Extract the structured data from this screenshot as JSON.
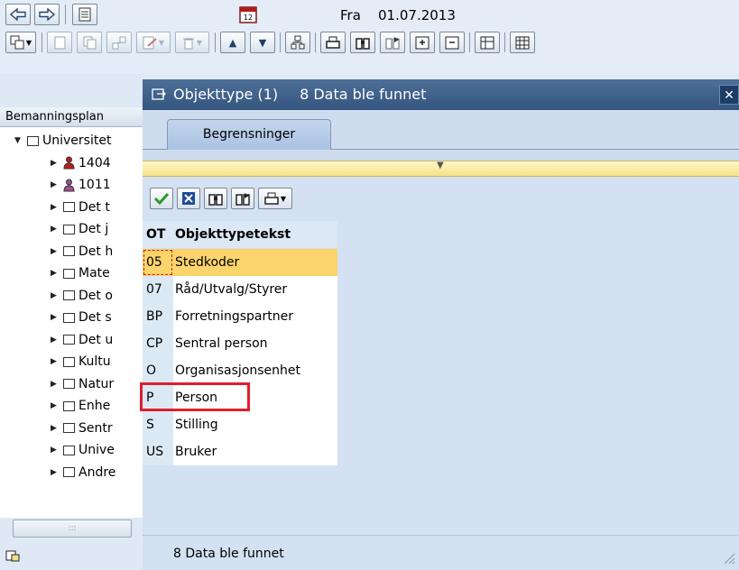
{
  "header": {
    "date_label": "Fra",
    "date_value": "01.07.2013"
  },
  "tree": {
    "header": "Bemanningsplan",
    "items": [
      {
        "label": "Universitet",
        "icon": "folder-icon",
        "level": 0,
        "expanded": true
      },
      {
        "label": "1404",
        "icon": "person-red-icon",
        "level": 1
      },
      {
        "label": "1011",
        "icon": "person-icon",
        "level": 1
      },
      {
        "label": "Det t",
        "icon": "folder-icon",
        "level": 1
      },
      {
        "label": "Det j",
        "icon": "folder-icon",
        "level": 1
      },
      {
        "label": "Det h",
        "icon": "folder-icon",
        "level": 1
      },
      {
        "label": "Mate",
        "icon": "folder-icon",
        "level": 1
      },
      {
        "label": "Det o",
        "icon": "folder-icon",
        "level": 1
      },
      {
        "label": "Det s",
        "icon": "folder-icon",
        "level": 1
      },
      {
        "label": "Det u",
        "icon": "folder-icon",
        "level": 1
      },
      {
        "label": "Kultu",
        "icon": "folder-icon",
        "level": 1
      },
      {
        "label": "Natur",
        "icon": "folder-icon",
        "level": 1
      },
      {
        "label": "Enhe",
        "icon": "folder-icon",
        "level": 1
      },
      {
        "label": "Sentr",
        "icon": "folder-icon",
        "level": 1
      },
      {
        "label": "Unive",
        "icon": "folder-icon",
        "level": 1
      },
      {
        "label": "Andre",
        "icon": "folder-icon",
        "level": 1
      }
    ]
  },
  "dialog": {
    "title": "Objekttype (1)",
    "title_info": "8 Data ble funnet",
    "tab_label": "Begrensninger",
    "columns": [
      "OT",
      "Objekttypetekst"
    ],
    "rows": [
      {
        "ot": "05",
        "text": "Stedkoder",
        "selected": true
      },
      {
        "ot": "07",
        "text": "Råd/Utvalg/Styrer"
      },
      {
        "ot": "BP",
        "text": "Forretningspartner"
      },
      {
        "ot": "CP",
        "text": "Sentral person"
      },
      {
        "ot": "O",
        "text": "Organisasjonsenhet"
      },
      {
        "ot": "P",
        "text": "Person",
        "highlighted": true
      },
      {
        "ot": "S",
        "text": "Stilling"
      },
      {
        "ot": "US",
        "text": "Bruker"
      }
    ],
    "status": "8 Data ble funnet"
  },
  "colors": {
    "title_bar": "#3f628d",
    "selected_row": "#fbd46b",
    "highlight_box": "#e01e2d",
    "collapse_bar": "#f6e289"
  }
}
